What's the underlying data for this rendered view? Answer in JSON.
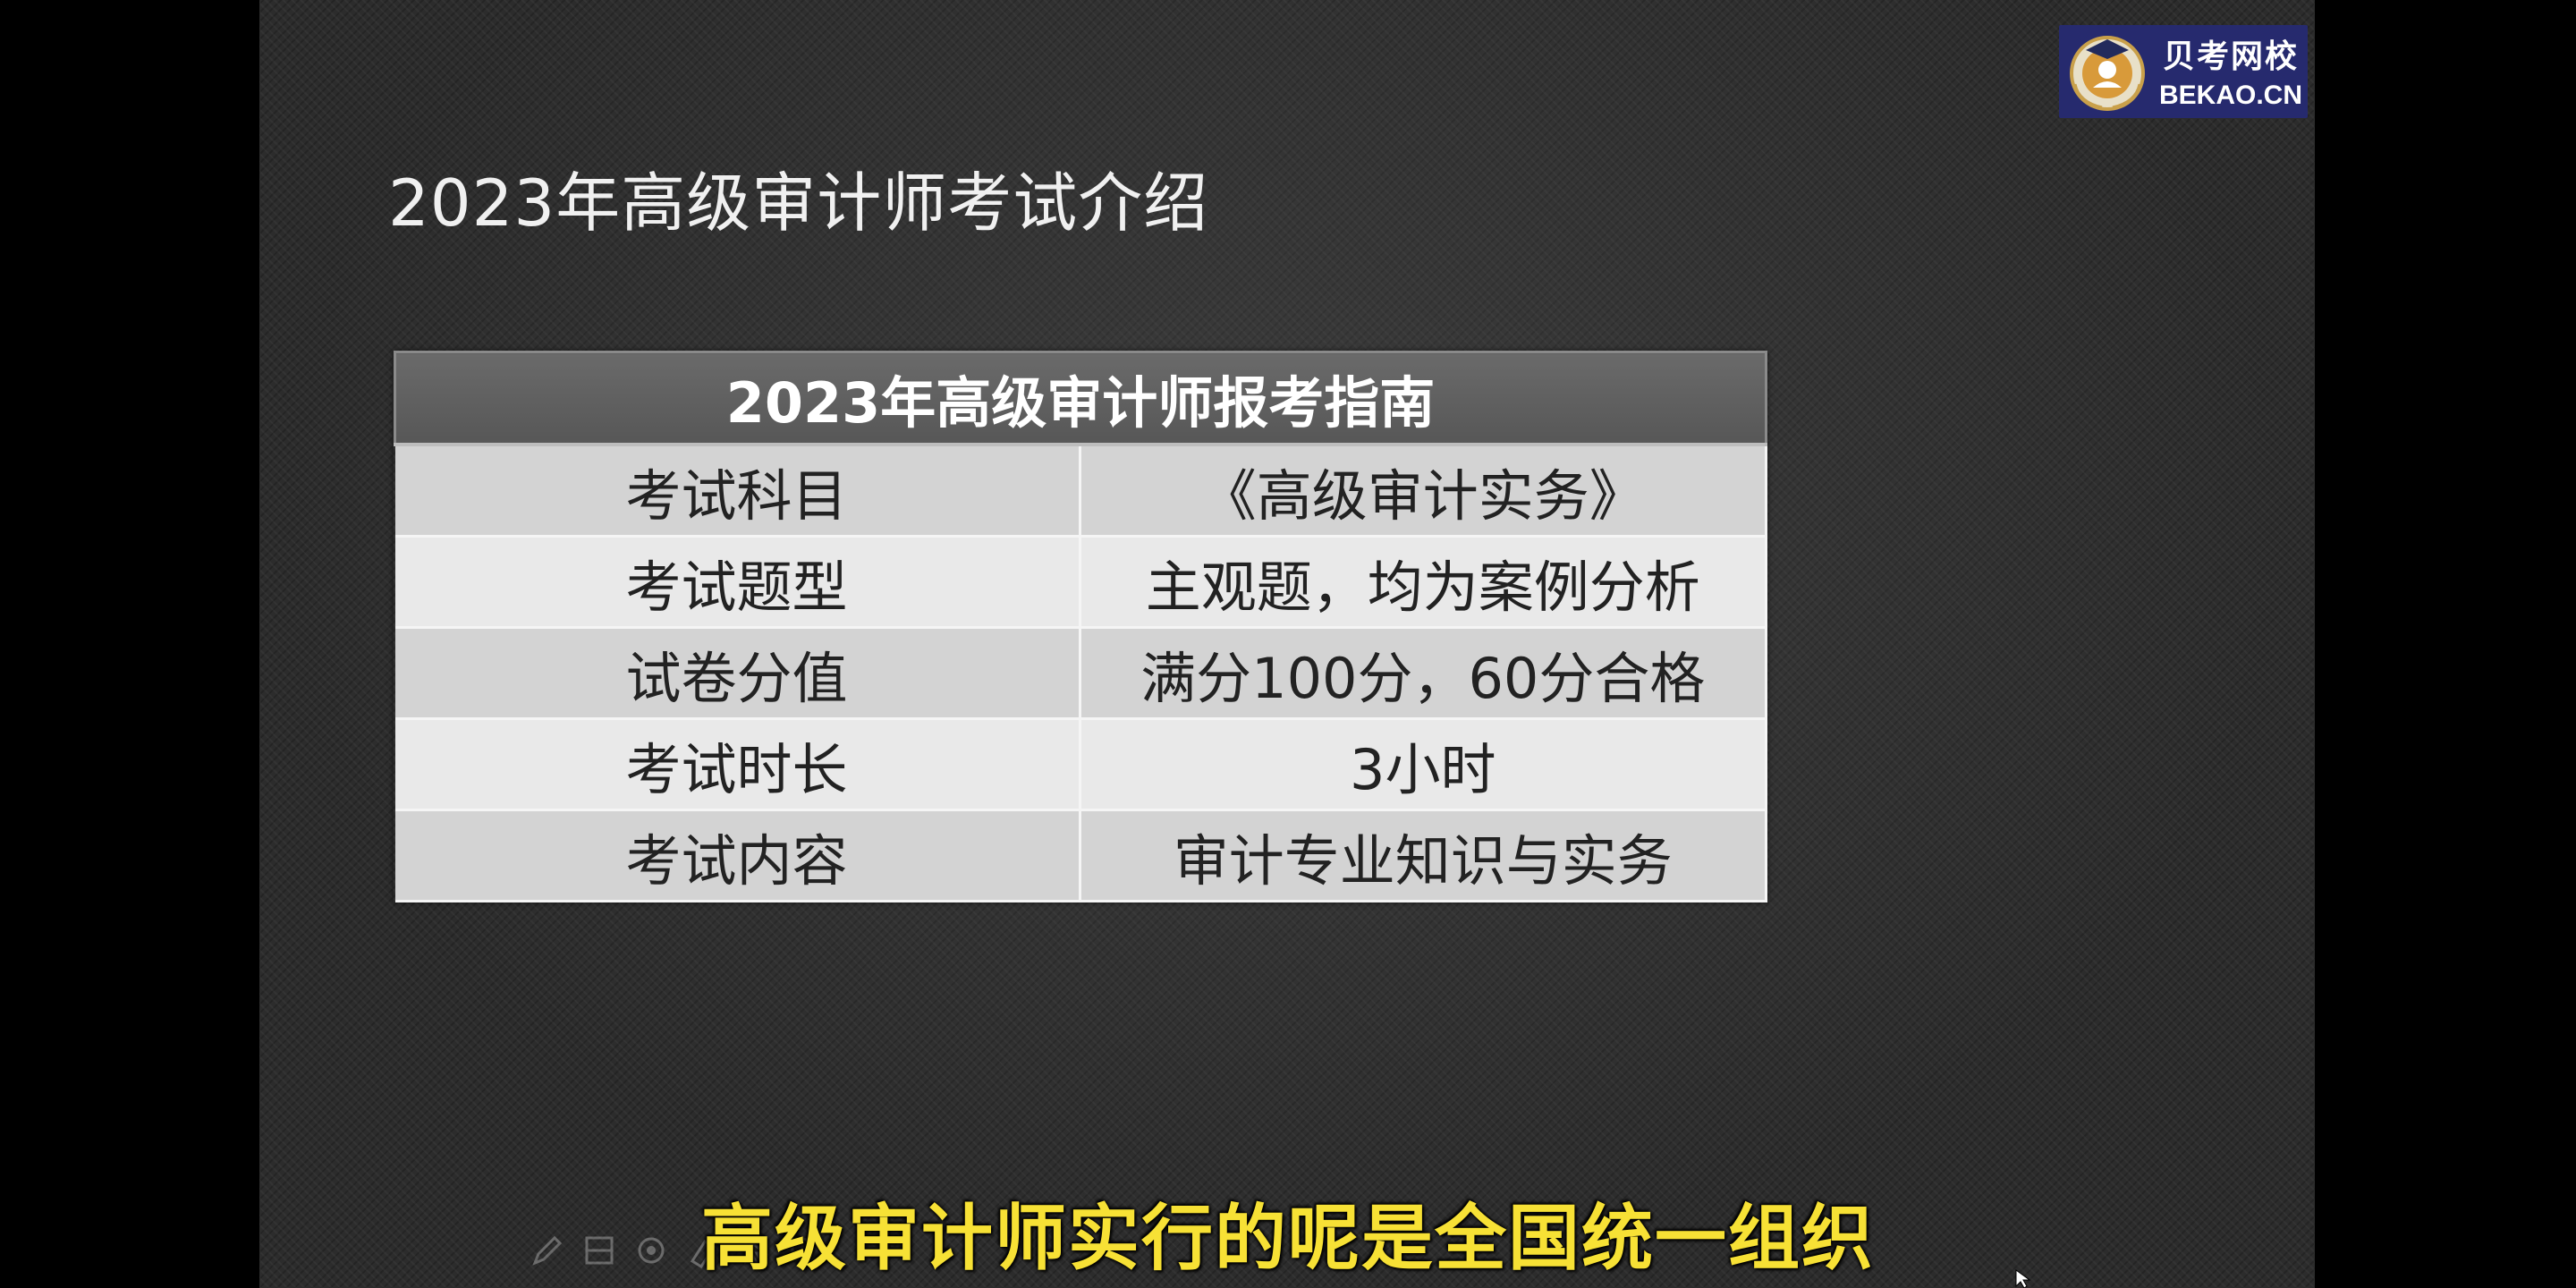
{
  "slide": {
    "title": "2023年高级审计师考试介绍"
  },
  "table": {
    "header": "2023年高级审计师报考指南",
    "rows": [
      {
        "label": "考试科目",
        "value": "《高级审计实务》"
      },
      {
        "label": "考试题型",
        "value": "主观题，均为案例分析"
      },
      {
        "label": "试卷分值",
        "value": "满分100分，60分合格"
      },
      {
        "label": "考试时长",
        "value": "3小时"
      },
      {
        "label": "考试内容",
        "value": "审计专业知识与实务"
      }
    ]
  },
  "logo": {
    "name_cn": "贝考网校",
    "name_en": "BEKAO.CN",
    "background": "#262a6e"
  },
  "subtitle": "高级审计师实行的呢是全国统一组织",
  "subtitle_color": "#f7e135",
  "toolbar": {
    "icons": [
      "pen-icon",
      "whiteboard-icon",
      "eraser-icon",
      "highlighter-icon",
      "pointer-icon",
      "screen-icon"
    ]
  }
}
